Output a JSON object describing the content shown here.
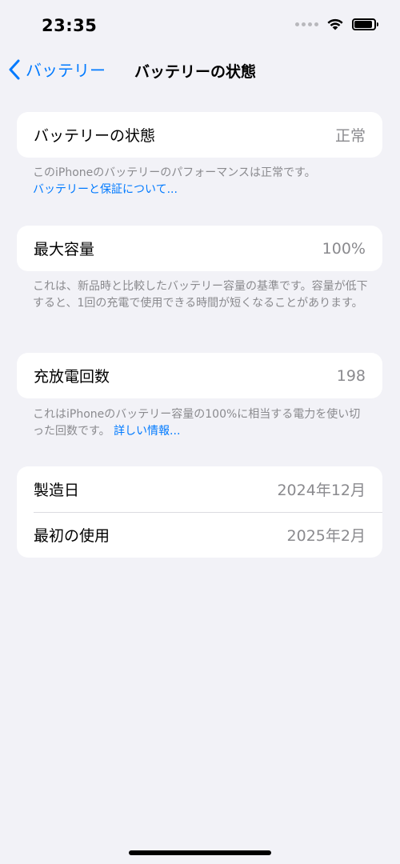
{
  "status_bar": {
    "time": "23:35",
    "battery_level": 0.9,
    "icons": [
      "cellular-dots-icon",
      "wifi-icon",
      "battery-icon"
    ]
  },
  "nav": {
    "back_label": "バッテリー",
    "title": "バッテリーの状態"
  },
  "sections": {
    "health": {
      "label": "バッテリーの状態",
      "value": "正常",
      "footnote": "このiPhoneのバッテリーのパフォーマンスは正常です。",
      "link": "バッテリーと保証について..."
    },
    "capacity": {
      "label": "最大容量",
      "value": "100%",
      "footnote": "これは、新品時と比較したバッテリー容量の基準です。容量が低下すると、1回の充電で使用できる時間が短くなることがあります。"
    },
    "cycles": {
      "label": "充放電回数",
      "value": "198",
      "footnote": "これはiPhoneのバッテリー容量の100%に相当する電力を使い切った回数です。",
      "link": "詳しい情報..."
    },
    "dates": {
      "manufacture_label": "製造日",
      "manufacture_value": "2024年12月",
      "first_use_label": "最初の使用",
      "first_use_value": "2025年2月"
    }
  },
  "colors": {
    "background": "#F2F2F7",
    "accent": "#007AFF",
    "secondary_text": "#8A8A8E"
  }
}
